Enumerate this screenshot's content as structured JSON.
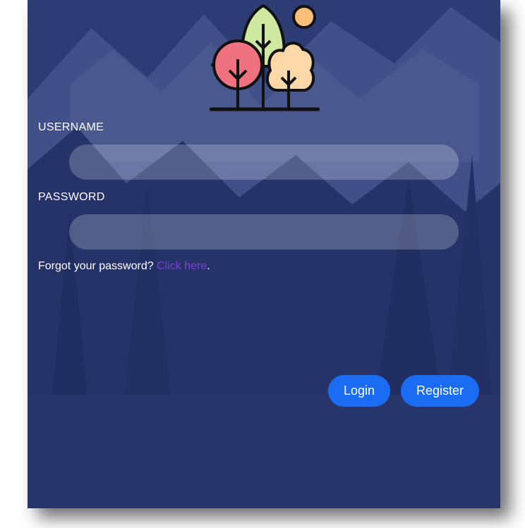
{
  "form": {
    "username_label": "USERNAME",
    "username_value": "",
    "password_label": "PASSWORD",
    "password_value": "",
    "forgot_text": "Forgot your password? ",
    "forgot_link": "Click here",
    "forgot_suffix": ".",
    "login_label": "Login",
    "register_label": "Register"
  },
  "colors": {
    "overlay": "#26347a",
    "button": "#1a6cf2",
    "link": "#7a3fd6",
    "tree_red": "#f0717f",
    "tree_green": "#cfe8a0",
    "tree_peach": "#fcd7a8",
    "sun": "#fbbf7a"
  },
  "icons": [
    "trees-logo-icon"
  ]
}
